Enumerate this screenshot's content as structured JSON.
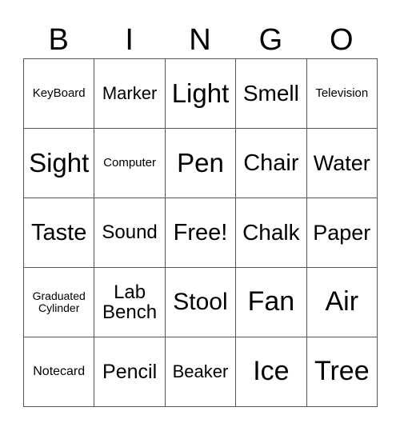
{
  "header": [
    "B",
    "I",
    "N",
    "G",
    "O"
  ],
  "rows": [
    [
      {
        "t": "KeyBoard",
        "s": 15
      },
      {
        "t": "Marker",
        "s": 22
      },
      {
        "t": "Light",
        "s": 33
      },
      {
        "t": "Smell",
        "s": 28
      },
      {
        "t": "Television",
        "s": 15
      }
    ],
    [
      {
        "t": "Sight",
        "s": 33
      },
      {
        "t": "Computer",
        "s": 15
      },
      {
        "t": "Pen",
        "s": 33
      },
      {
        "t": "Chair",
        "s": 29
      },
      {
        "t": "Water",
        "s": 27
      }
    ],
    [
      {
        "t": "Taste",
        "s": 29
      },
      {
        "t": "Sound",
        "s": 24
      },
      {
        "t": "Free!",
        "s": 29
      },
      {
        "t": "Chalk",
        "s": 28
      },
      {
        "t": "Paper",
        "s": 27
      }
    ],
    [
      {
        "t": "Graduated Cylinder",
        "s": 14
      },
      {
        "t": "Lab Bench",
        "s": 24
      },
      {
        "t": "Stool",
        "s": 30
      },
      {
        "t": "Fan",
        "s": 34
      },
      {
        "t": "Air",
        "s": 34
      }
    ],
    [
      {
        "t": "Notecard",
        "s": 16
      },
      {
        "t": "Pencil",
        "s": 25
      },
      {
        "t": "Beaker",
        "s": 22
      },
      {
        "t": "Ice",
        "s": 34
      },
      {
        "t": "Tree",
        "s": 34
      }
    ]
  ]
}
